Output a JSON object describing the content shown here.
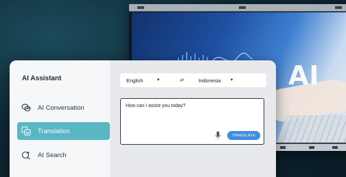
{
  "background": {
    "screen_text": "AI"
  },
  "assistant": {
    "title": "AI Assistant",
    "nav": [
      {
        "label": "AI Conversation",
        "icon": "chat-bubbles-icon",
        "active": false
      },
      {
        "label": "Translation",
        "icon": "translate-icon",
        "active": true
      },
      {
        "label": "AI Search",
        "icon": "ai-search-icon",
        "active": false
      }
    ],
    "source_language": "English",
    "swap_symbol": "⇄",
    "target_language": "Indonesia",
    "input_placeholder": "How can I assist you today?",
    "translate_label": "TRANSLATE"
  },
  "colors": {
    "accent": "#5bb6c4",
    "button": "#3c8fe0"
  }
}
